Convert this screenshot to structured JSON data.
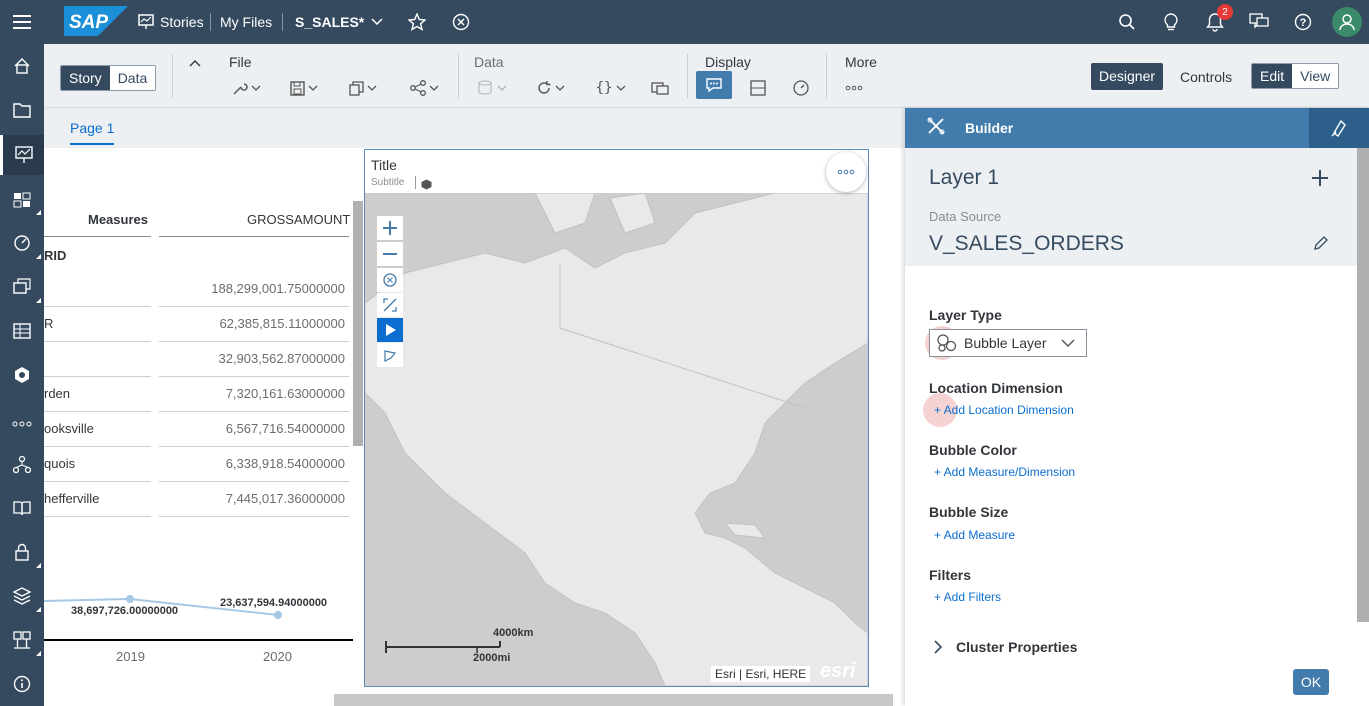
{
  "shell": {
    "stories_label": "Stories",
    "myfiles_label": "My Files",
    "story_name": "S_SALES*",
    "notification_count": "2"
  },
  "toolbar": {
    "story_label": "Story",
    "data_label": "Data",
    "file_label": "File",
    "data_group_label": "Data",
    "display_label": "Display",
    "more_label": "More",
    "designer_label": "Designer",
    "controls_label": "Controls",
    "edit_label": "Edit",
    "view_label": "View"
  },
  "tabs": {
    "page1": "Page 1"
  },
  "table": {
    "measures_header": "Measures",
    "gross_header": "GROSSAMOUNT",
    "group_label": "RID",
    "rows": [
      {
        "label": "",
        "value": "188,299,001.75000000"
      },
      {
        "label": "R",
        "value": "62,385,815.11000000"
      },
      {
        "label": "",
        "value": "32,903,562.87000000"
      },
      {
        "label": "rden",
        "value": "7,320,161.63000000"
      },
      {
        "label": "ooksville",
        "value": "6,567,716.54000000"
      },
      {
        "label": "quois",
        "value": "6,338,918.54000000"
      },
      {
        "label": "hefferville",
        "value": "7,445,017.36000000"
      }
    ]
  },
  "linechart": {
    "point1_label": "38,697,726.00000000",
    "point2_label": "23,637,594.94000000",
    "year1": "2019",
    "year2": "2020"
  },
  "mapwidget": {
    "title": "Title",
    "subtitle": "Subtitle",
    "scale_km": "4000km",
    "scale_mi": "2000mi",
    "attribution": "Esri | Esri, HERE",
    "esri_logo": "esri"
  },
  "builder": {
    "header": "Builder",
    "layer_title": "Layer 1",
    "data_source_label": "Data Source",
    "data_source_value": "V_SALES_ORDERS",
    "layer_type_label": "Layer Type",
    "layer_type_value": "Bubble Layer",
    "location_dim_label": "Location Dimension",
    "location_dim_link": "+ Add Location Dimension",
    "bubble_color_label": "Bubble Color",
    "bubble_color_link": "+ Add Measure/Dimension",
    "bubble_size_label": "Bubble Size",
    "bubble_size_link": "+ Add Measure",
    "filters_label": "Filters",
    "filters_link": "+ Add Filters",
    "cluster_label": "Cluster Properties",
    "ok_label": "OK"
  },
  "colors": {
    "shell": "#354a5f",
    "accent": "#427cac",
    "link": "#0a6ed1"
  }
}
